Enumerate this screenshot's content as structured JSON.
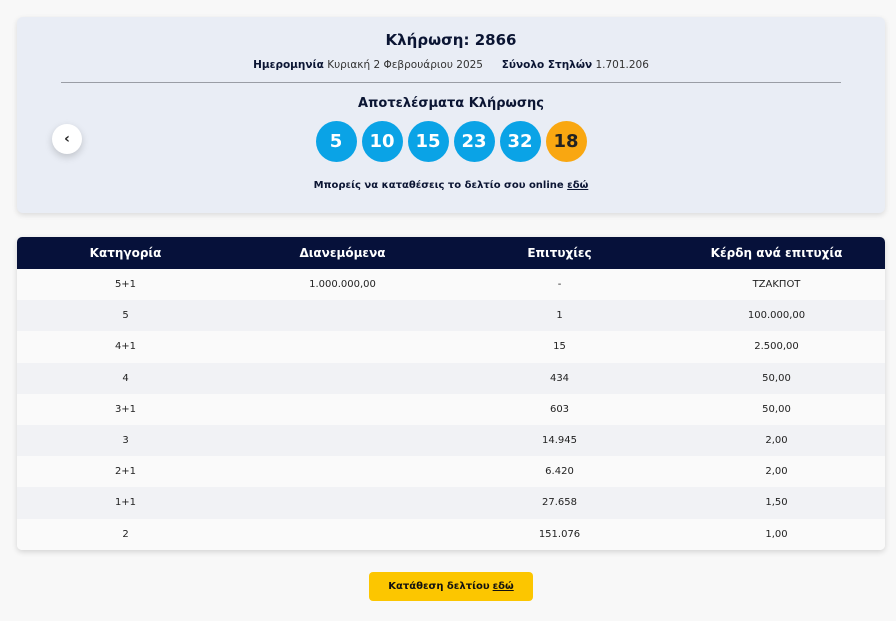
{
  "draw": {
    "title": "Κλήρωση: 2866",
    "date_label": "Ημερομηνία",
    "date_value": "Κυριακή 2 Φεβρουάριου 2025",
    "columns_label": "Σύνολο Στηλών",
    "columns_value": "1.701.206",
    "results_title": "Αποτελέσματα Κλήρωσης",
    "numbers": [
      "5",
      "10",
      "15",
      "23",
      "32"
    ],
    "bonus": "18",
    "online_text": "Μπορείς να καταθέσεις το δελτίο σου online",
    "online_link": "εδώ",
    "prev_icon": "chevron-left-icon",
    "colors": {
      "ball": "#0aa3e6",
      "bonus": "#f9a711",
      "header": "#06113a",
      "button": "#fcc600"
    }
  },
  "table": {
    "headers": [
      "Κατηγορία",
      "Διανεμόμενα",
      "Επιτυχίες",
      "Κέρδη ανά επιτυχία"
    ],
    "rows": [
      [
        "5+1",
        "1.000.000,00",
        "-",
        "ΤΖΑΚΠΟΤ"
      ],
      [
        "5",
        "",
        "1",
        "100.000,00"
      ],
      [
        "4+1",
        "",
        "15",
        "2.500,00"
      ],
      [
        "4",
        "",
        "434",
        "50,00"
      ],
      [
        "3+1",
        "",
        "603",
        "50,00"
      ],
      [
        "3",
        "",
        "14.945",
        "2,00"
      ],
      [
        "2+1",
        "",
        "6.420",
        "2,00"
      ],
      [
        "1+1",
        "",
        "27.658",
        "1,50"
      ],
      [
        "2",
        "",
        "151.076",
        "1,00"
      ]
    ]
  },
  "submit": {
    "label": "Κατάθεση δελτίου",
    "link": "εδώ"
  }
}
